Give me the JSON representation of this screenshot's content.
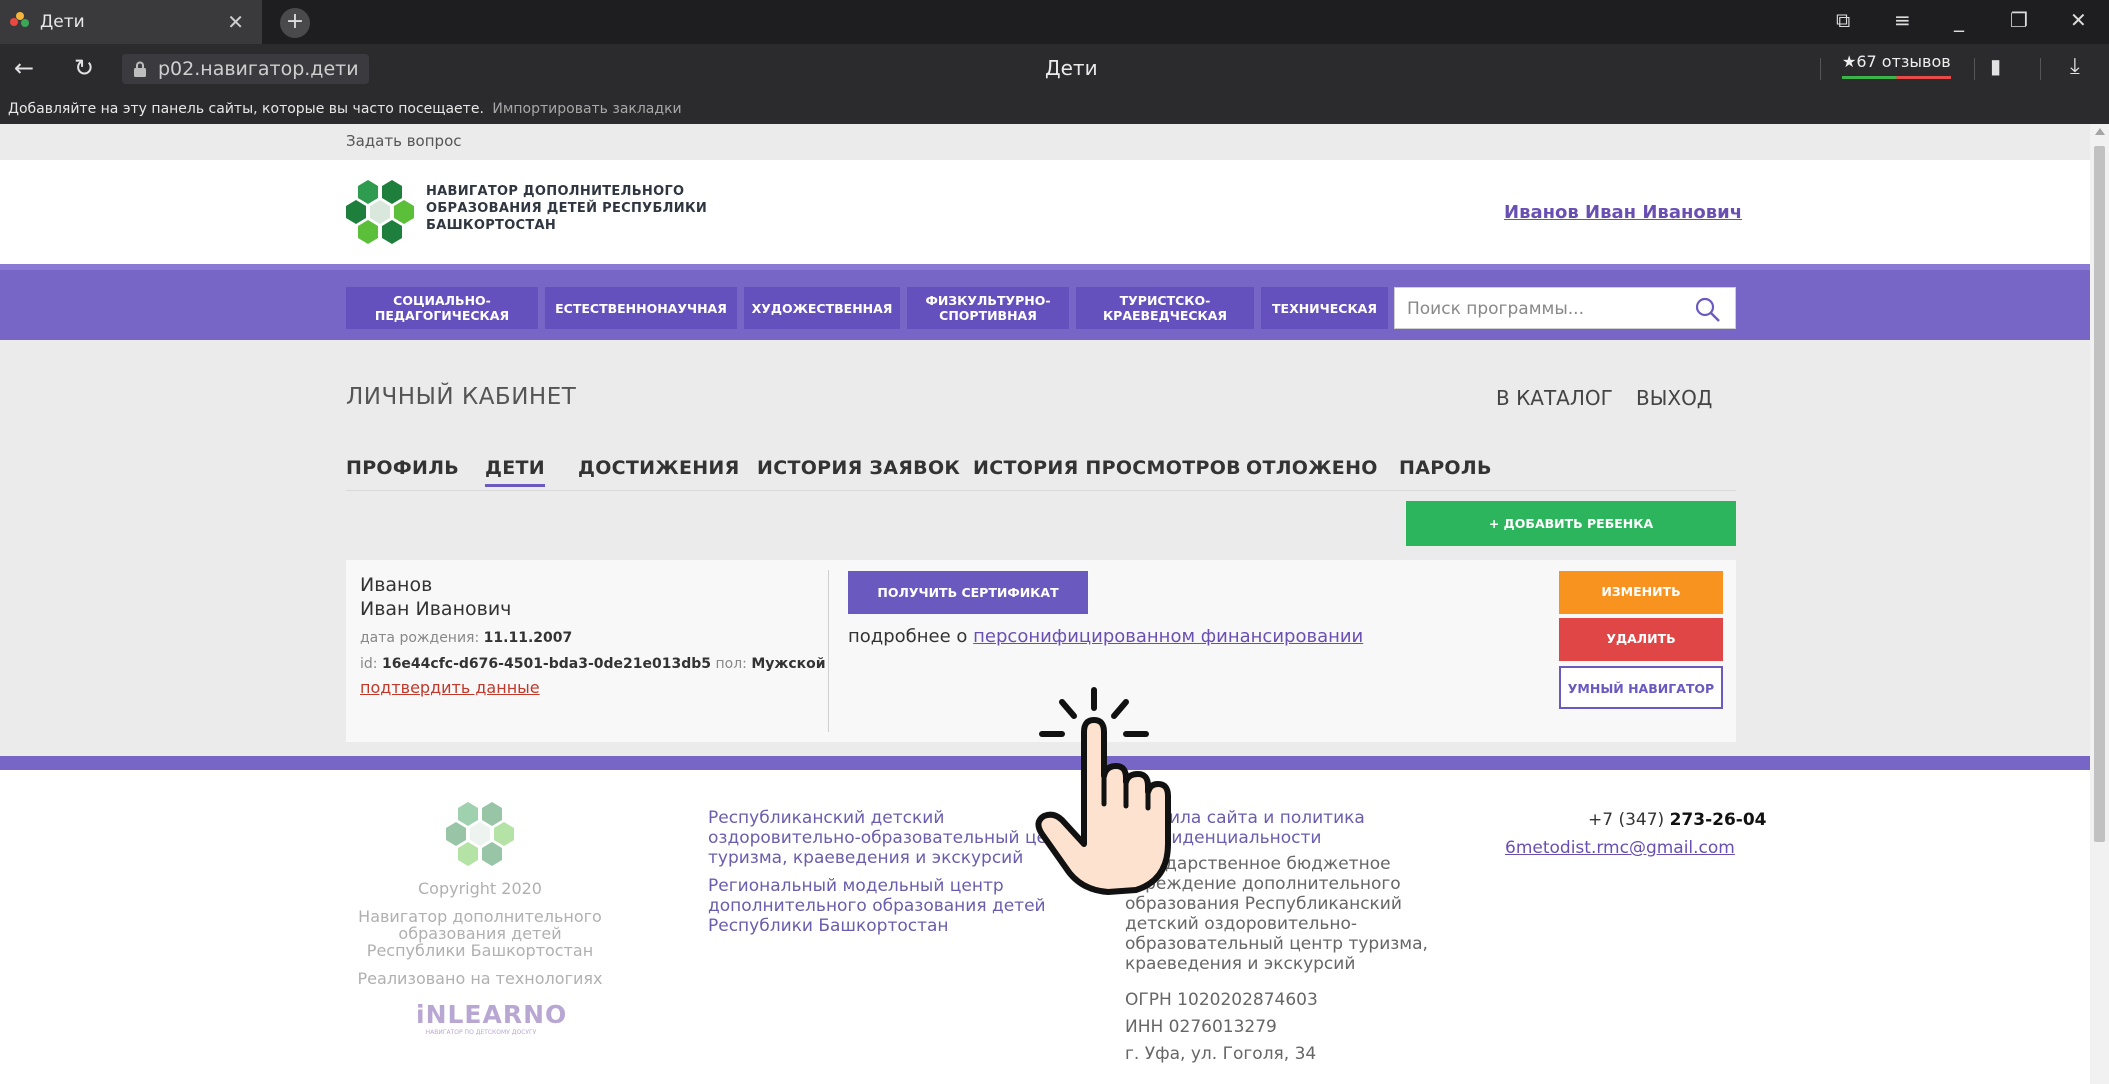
{
  "browser": {
    "tab_title": "Дети",
    "url": "p02.навигатор.дети",
    "page_title": "Дети",
    "reviews": "★67 отзывов",
    "bookmarks_hint": "Добавляйте на эту панель сайты, которые вы часто посещаете.",
    "bookmarks_import": "Импортировать закладки"
  },
  "site": {
    "ask_link": "Задать вопрос",
    "logo_lines": [
      "НАВИГАТОР ДОПОЛНИТЕЛЬНОГО",
      "ОБРАЗОВАНИЯ ДЕТЕЙ РЕСПУБЛИКИ",
      "БАШКОРТОСТАН"
    ],
    "user_name": "Иванов Иван Иванович",
    "categories": [
      {
        "label": "СОЦИАЛЬНО- ПЕДАГОГИЧЕСКАЯ"
      },
      {
        "label": "ЕСТЕСТВЕННОНАУЧНАЯ"
      },
      {
        "label": "ХУДОЖЕСТВЕННАЯ"
      },
      {
        "label": "ФИЗКУЛЬТУРНО- СПОРТИВНАЯ"
      },
      {
        "label": "ТУРИСТСКО- КРАЕВЕДЧЕСКАЯ"
      },
      {
        "label": "ТЕХНИЧЕСКАЯ"
      }
    ],
    "search_placeholder": "Поиск программы..."
  },
  "cabinet": {
    "title": "ЛИЧНЫЙ КАБИНЕТ",
    "catalog_link": "В КАТАЛОГ",
    "logout_link": "ВЫХОД",
    "tabs": [
      {
        "label": "ПРОФИЛЬ"
      },
      {
        "label": "ДЕТИ",
        "active": true
      },
      {
        "label": "ДОСТИЖЕНИЯ"
      },
      {
        "label": "ИСТОРИЯ ЗАЯВОК"
      },
      {
        "label": "ИСТОРИЯ ПРОСМОТРОВ"
      },
      {
        "label": "ОТЛОЖЕНО"
      },
      {
        "label": "ПАРОЛЬ"
      }
    ],
    "add_child": "+ ДОБАВИТЬ РЕБЕНКА"
  },
  "child": {
    "surname": "Иванов",
    "name": "Иван Иванович",
    "birth_label": "дата рождения:",
    "birth_date": "11.11.2007",
    "id_label": "id:",
    "id": "16e44cfc-d676-4501-bda3-0de21e013db5",
    "sex_label": "пол:",
    "sex": "Мужской",
    "confirm_link": "подтвердить данные",
    "cert_button": "ПОЛУЧИТЬ СЕРТИФИКАТ",
    "more_prefix": "подробнее о",
    "more_link": "персонифицированном финансировании",
    "edit_button": "ИЗМЕНИТЬ",
    "delete_button": "УДАЛИТЬ",
    "smart_button": "УМНЫЙ НАВИГАТОР"
  },
  "footer": {
    "copyright": "Copyright 2020",
    "org_name": "Навигатор дополнительного образования детей Республики Башкортостан",
    "tech": "Реализовано на технологиях",
    "inlearno": "iNLEARNO",
    "inlearno_sub": "НАВИГАТОР ПО ДЕТСКОМУ ДОСУГУ",
    "col1a": "Республиканский детский оздоровительно-образовательный центр туризма, краеведения и экскурсий",
    "col1b": "Региональный модельный центр дополнительного образования детей Республики Башкортостан",
    "rules": "Правила сайта и политика конфиденциальности",
    "gbu": "Государственное бюджетное учреждение дополнительного образования Республиканский детский оздоровительно-образовательный центр туризма, краеведения и экскурсий",
    "ogrn": "ОГРН 1020202874603",
    "inn": "ИНН 0276013279",
    "address": "г. Уфа, ул. Гоголя, 34",
    "phone_prefix": "+7 (347)",
    "phone_number": "273-26-04",
    "email": "6metodist.rmc@gmail.com"
  },
  "colors": {
    "purple": "#7866c7",
    "green": "#2db55d",
    "orange": "#f7931e",
    "red": "#e04646"
  }
}
